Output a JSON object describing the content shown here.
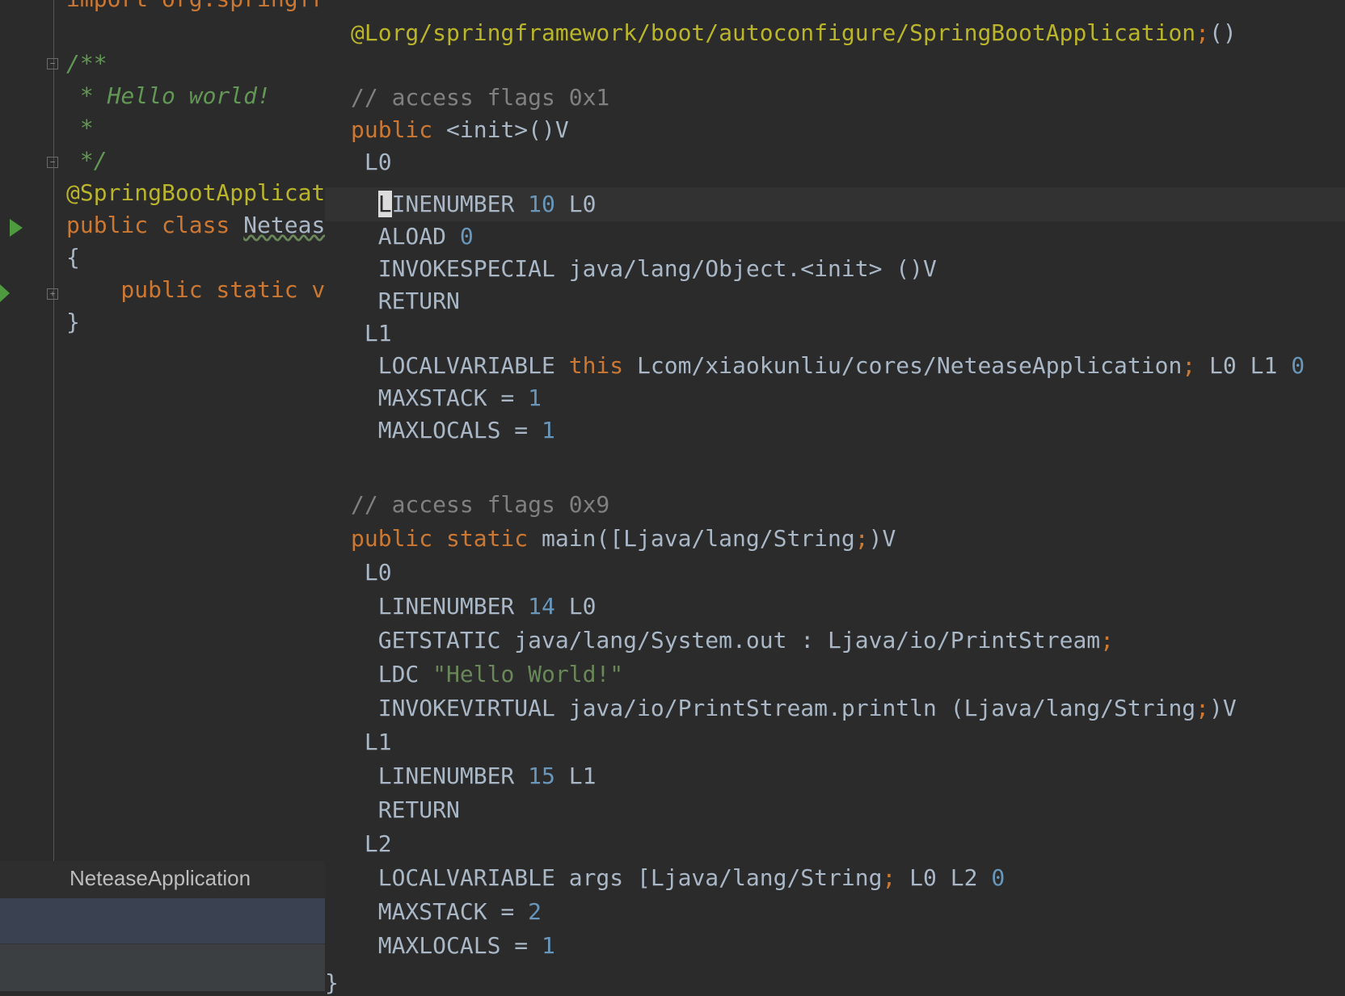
{
  "left_editor": {
    "line_import": "import org.springfra",
    "doc_open": "/**",
    "doc_hello": " * Hello world!",
    "doc_star": " *",
    "doc_close": " */",
    "annotation": "@SpringBootApplicati",
    "class_kw": "public class ",
    "class_name": "Netease",
    "open_brace": "{",
    "method_kw": "    public static vo",
    "close_brace": "}"
  },
  "file_tab": {
    "label": "NeteaseApplication"
  },
  "bytecode": {
    "header_ann": "@Lorg/springframework/boot/autoconfigure/SpringBootApplication",
    "header_semi": ";",
    "header_paren": "()",
    "cmt1": "// access flags 0x1",
    "init_kw": "public",
    "init_sig": " <init>()V",
    "l0": " L0",
    "ln10_caret": "L",
    "ln10_text": "INENUMBER ",
    "ln10_num": "10",
    "ln10_label": " L0",
    "aload_text": "  ALOAD ",
    "aload_num": "0",
    "invokespecial": "  INVOKESPECIAL java/lang/Object.<init> ()V",
    "return1": "  RETURN",
    "l1": " L1",
    "localvar_kw_prefix": "  LOCALVARIABLE ",
    "localvar_this": "this",
    "localvar_type": " Lcom/xiaokunliu/cores/NeteaseApplication",
    "localvar_semi": ";",
    "localvar_labels": " L0 L1 ",
    "localvar_idx": "0",
    "maxstack1_text": "  MAXSTACK = ",
    "maxstack1_num": "1",
    "maxlocals1_text": "  MAXLOCALS = ",
    "maxlocals1_num": "1",
    "cmt2": "// access flags 0x9",
    "main_kw": "public static",
    "main_sig": " main([Ljava/lang/String",
    "main_semi": ";",
    "main_end": ")V",
    "l0b": " L0",
    "ln14_text": "  LINENUMBER ",
    "ln14_num": "14",
    "ln14_label": " L0",
    "getstatic_text": "  GETSTATIC java/lang/System.out : Ljava/io/PrintStream",
    "getstatic_semi": ";",
    "ldc_text": "  LDC ",
    "ldc_str": "\"Hello World!\"",
    "invokevirtual_text": "  INVOKEVIRTUAL java/io/PrintStream.println (Ljava/lang/String",
    "invokevirtual_semi": ";",
    "invokevirtual_end": ")V",
    "l1b": " L1",
    "ln15_text": "  LINENUMBER ",
    "ln15_num": "15",
    "ln15_label": " L1",
    "return2": "  RETURN",
    "l2": " L2",
    "localvar2_text": "  LOCALVARIABLE args [Ljava/lang/String",
    "localvar2_semi": ";",
    "localvar2_labels": " L0 L2 ",
    "localvar2_idx": "0",
    "maxstack2_text": "  MAXSTACK = ",
    "maxstack2_num": "2",
    "maxlocals2_text": "  MAXLOCALS = ",
    "maxlocals2_num": "1",
    "close_brace": "}"
  },
  "colors": {
    "background": "#2b2b2b",
    "keyword": "#cc7832",
    "number": "#6897bb",
    "string": "#6a8759",
    "comment": "#808080",
    "annotation": "#bbb529",
    "doc_comment": "#629755",
    "text": "#a9b7c6"
  },
  "icons": [
    "run-gutter-icon",
    "fold-icon"
  ]
}
